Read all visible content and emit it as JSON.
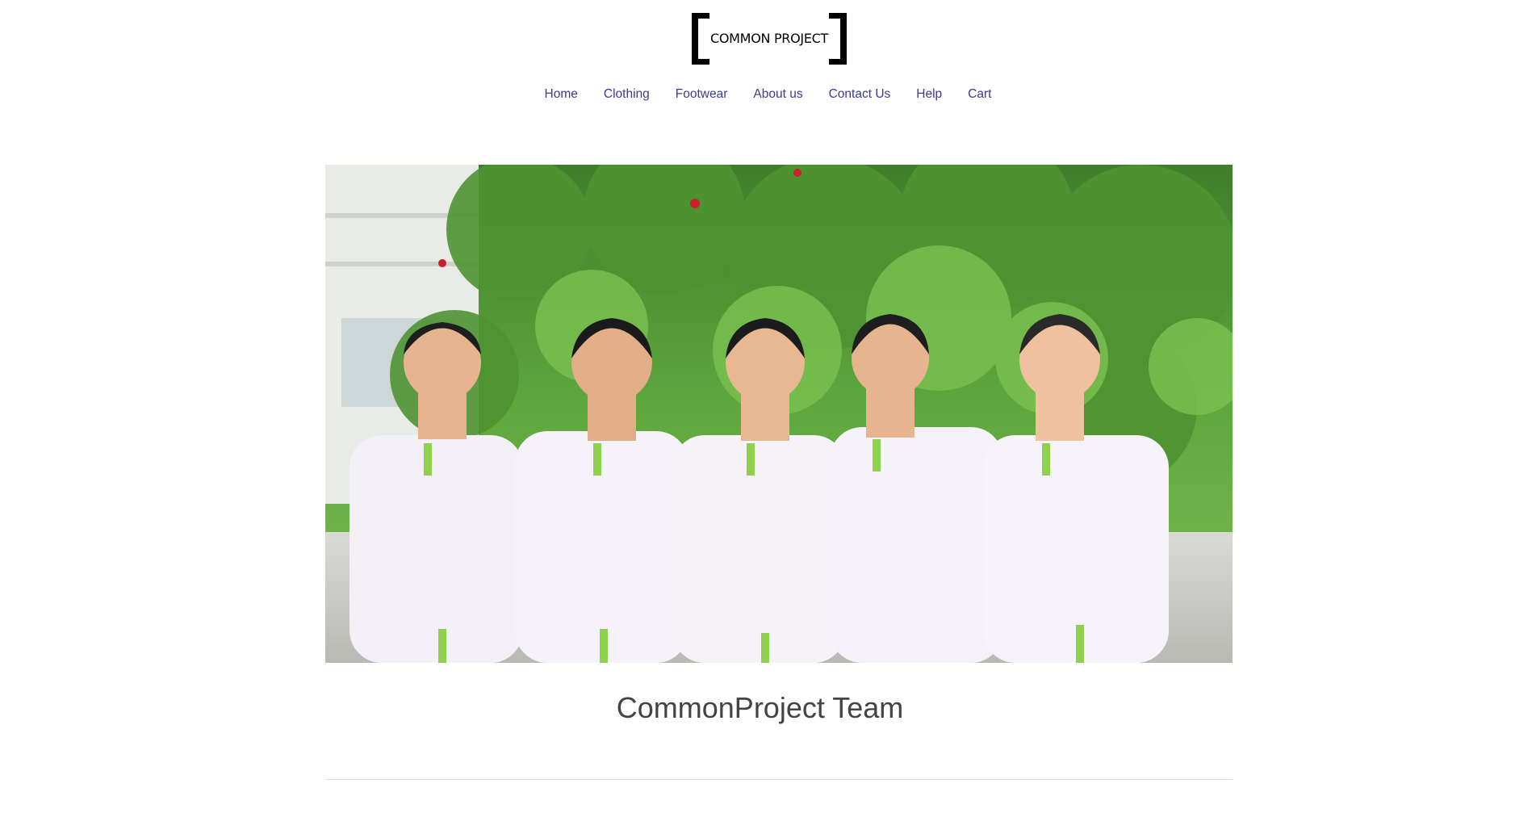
{
  "brand": {
    "logo_text": "COMMON PROJECT"
  },
  "nav": {
    "items": [
      {
        "label": "Home"
      },
      {
        "label": "Clothing"
      },
      {
        "label": "Footwear"
      },
      {
        "label": "About us"
      },
      {
        "label": "Contact Us"
      },
      {
        "label": "Help"
      },
      {
        "label": "Cart"
      }
    ]
  },
  "hero": {
    "icon": "team-photo-image"
  },
  "main": {
    "title": "CommonProject Team"
  },
  "colors": {
    "nav_link": "#3b3b8f",
    "title": "#444444",
    "divider": "#dcdcdc"
  }
}
